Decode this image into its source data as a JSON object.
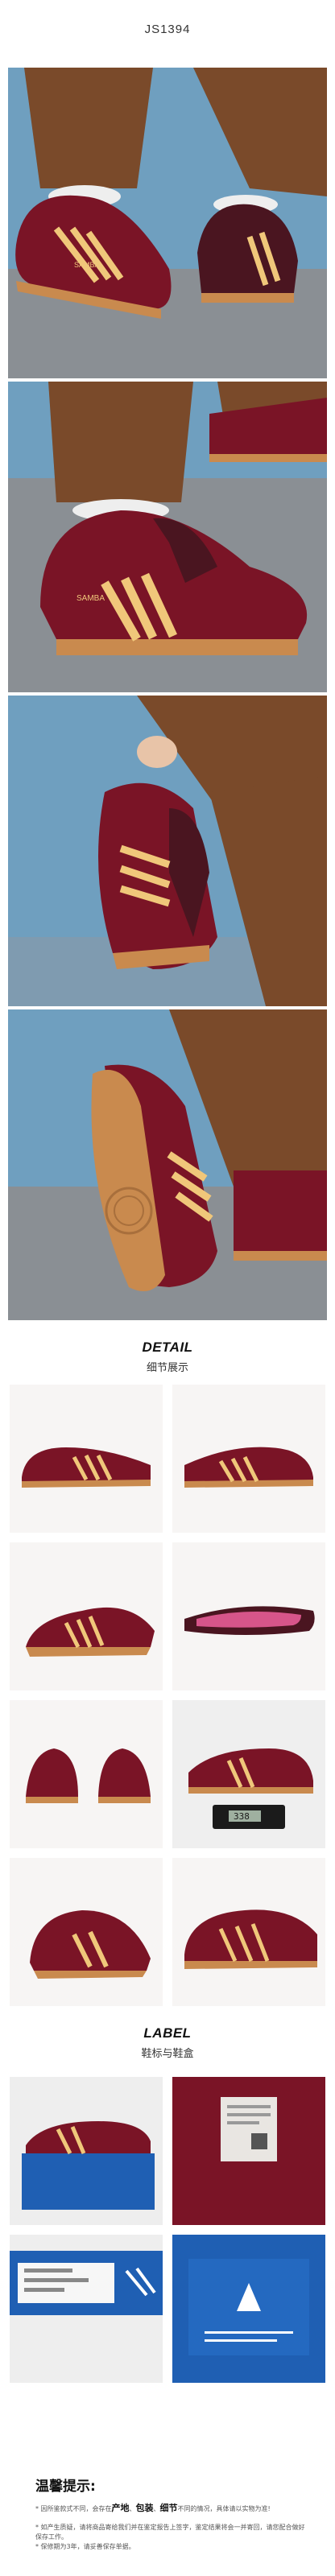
{
  "header": {
    "product_code": "JS1394"
  },
  "detail_section": {
    "title_en": "DETAIL",
    "title_cn": "细节展示"
  },
  "label_section": {
    "title_en": "LABEL",
    "title_cn": "鞋标与鞋盒"
  },
  "shoe": {
    "side_text": "SAMBA"
  },
  "scale": {
    "reading": "338"
  },
  "notice": {
    "title": "温馨提示:",
    "line1_prefix": "* 因所鉴款式不同，会存在",
    "line1_bold1": "产地",
    "line1_sep1": "、",
    "line1_bold2": "包装",
    "line1_sep2": "、",
    "line1_bold3": "细节",
    "line1_suffix": "不同的情况，具体请以实物为准!",
    "line2": "* 如产生质疑，请将商品寄给我们并在鉴定报告上签字，鉴定结果将会一并寄回，请您配合做好保存工作。",
    "line3": "* 保修期为3年，请妥善保存单据。"
  },
  "colors": {
    "burgundy": "#7a1426",
    "maroon": "#4a1520",
    "stripe": "#f0c77a",
    "gum": "#c98a4e",
    "pants": "#7a4a2a",
    "sky": "#6f9fbf",
    "box_blue": "#1f5fb3"
  }
}
